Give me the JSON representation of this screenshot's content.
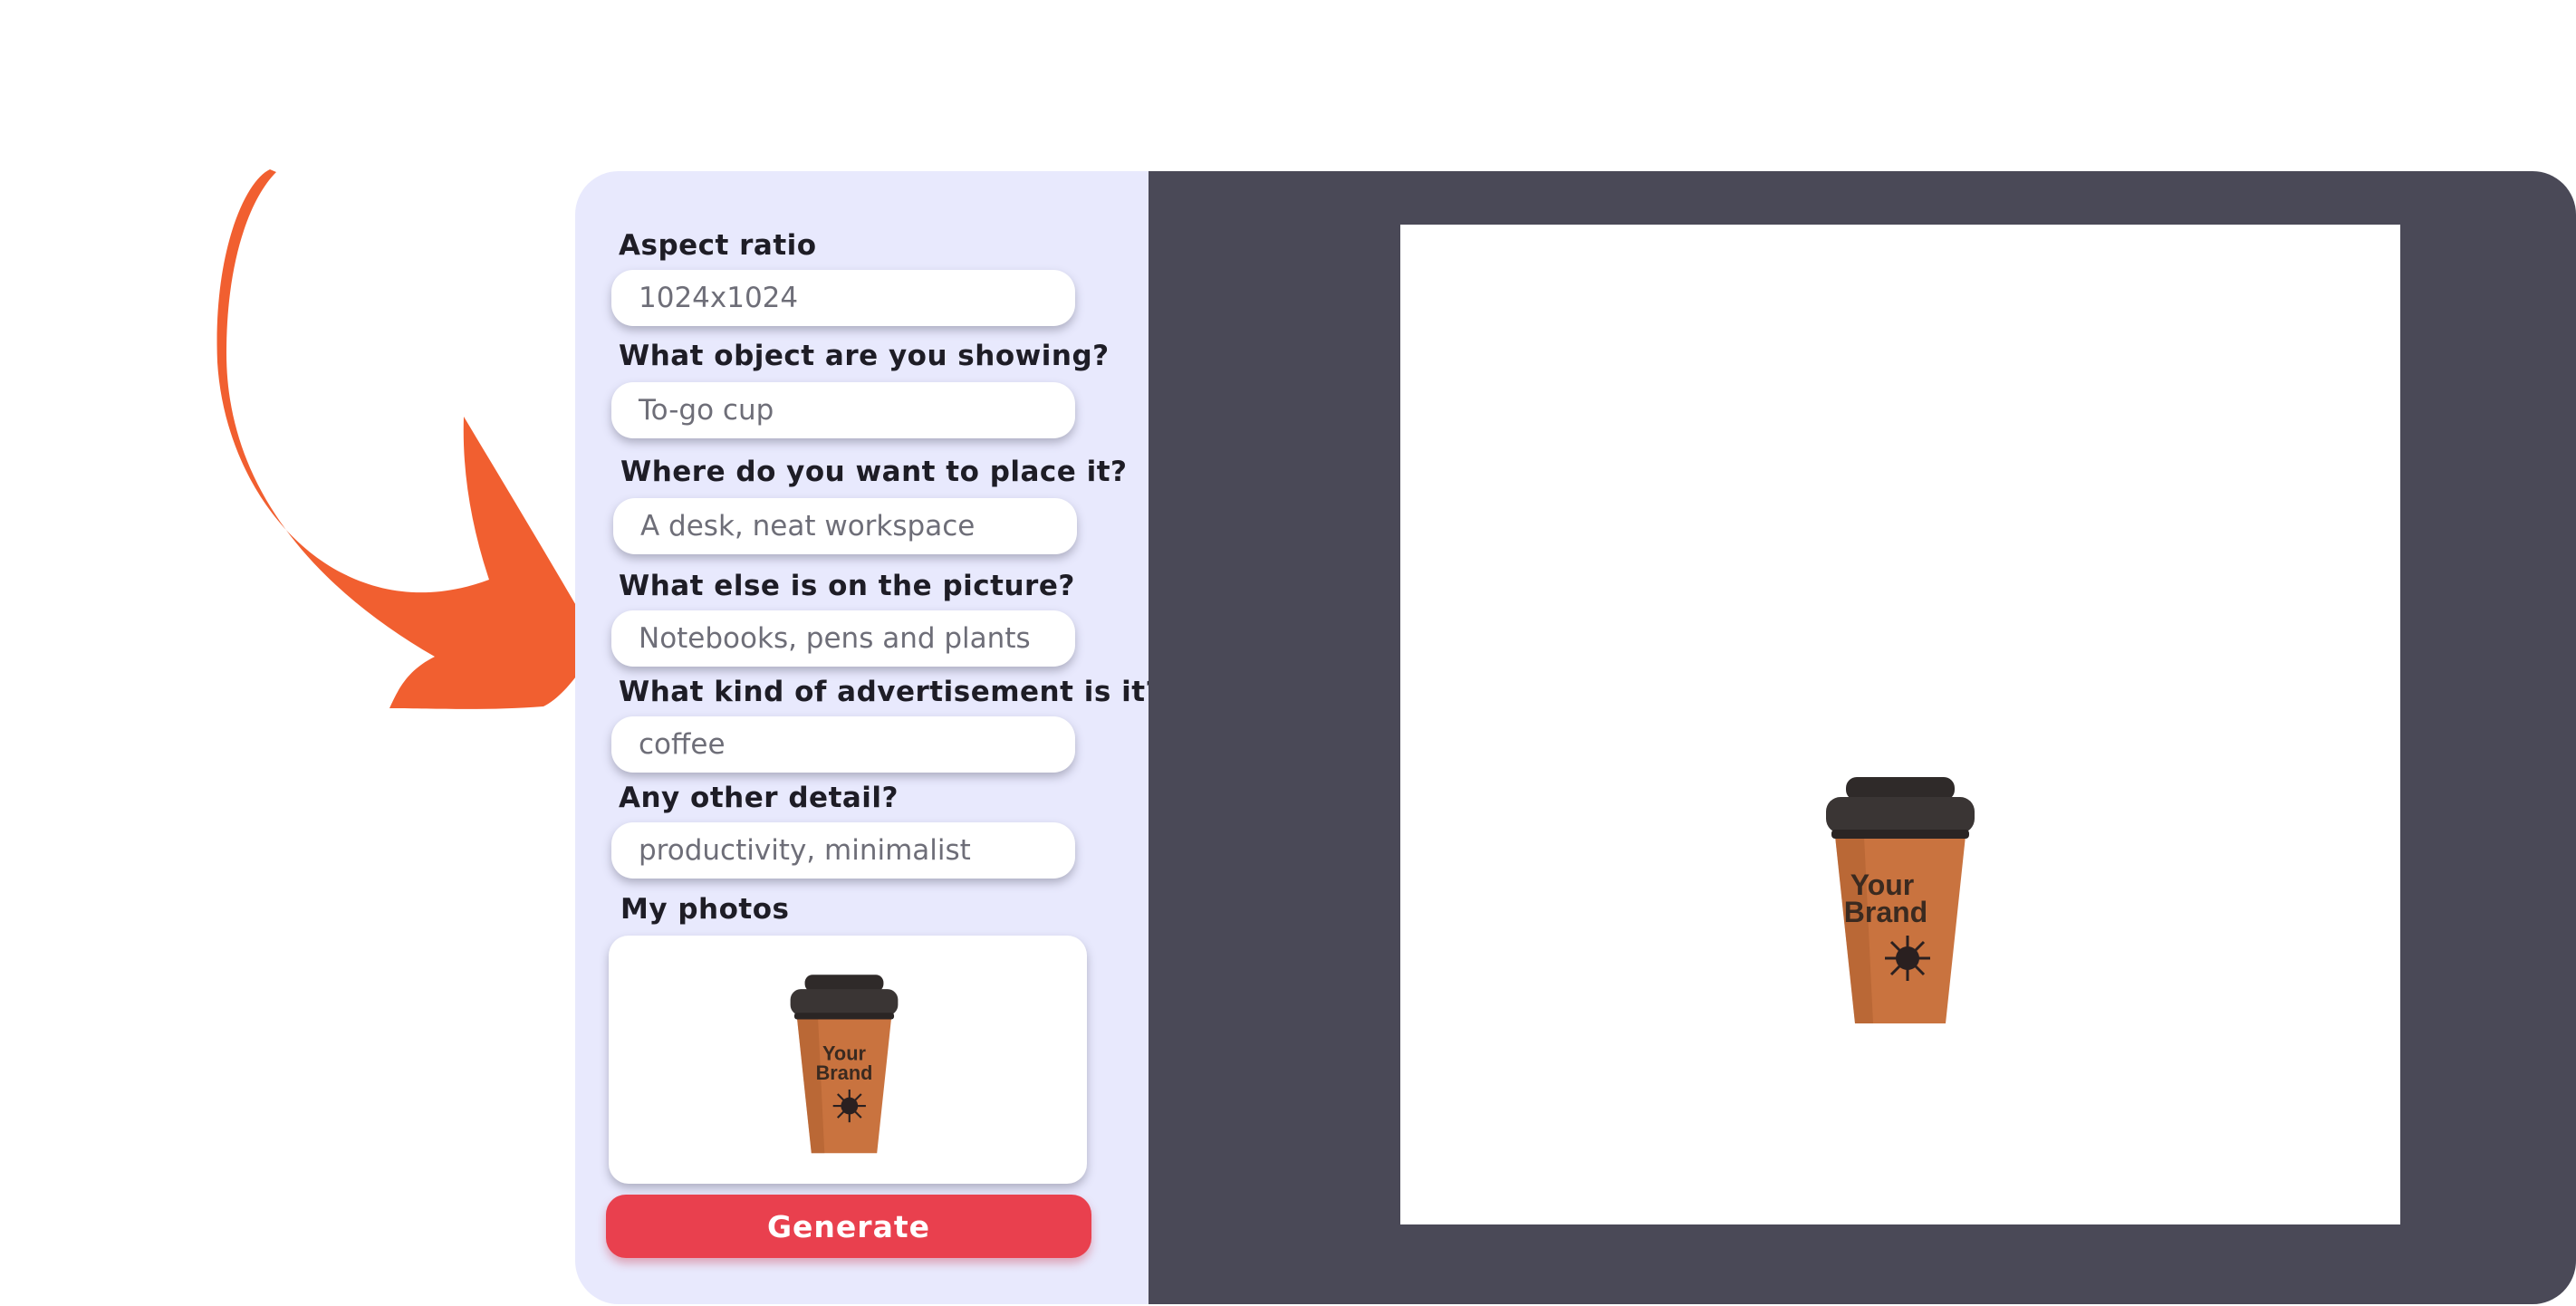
{
  "form": {
    "fields": [
      {
        "label": "Aspect ratio",
        "value": "1024x1024"
      },
      {
        "label": "What object are you showing?",
        "value": "To-go cup"
      },
      {
        "label": "Where do you want to place it?",
        "value": "A desk, neat workspace"
      },
      {
        "label": "What else is on the picture?",
        "value": "Notebooks, pens and plants"
      },
      {
        "label": "What kind of advertisement is it?",
        "value": "coffee"
      },
      {
        "label": "Any other detail?",
        "value": "productivity, minimalist"
      }
    ],
    "photos_label": "My photos",
    "generate_label": "Generate"
  },
  "cup_brand": {
    "line1": "Your",
    "line2": "Brand"
  },
  "colors": {
    "panel_bg": "#e8e9fd",
    "preview_bg": "#4a4957",
    "accent": "#e9404e",
    "arrow": "#f15f30",
    "cup": "#c9733f",
    "lid": "#3a3534"
  }
}
